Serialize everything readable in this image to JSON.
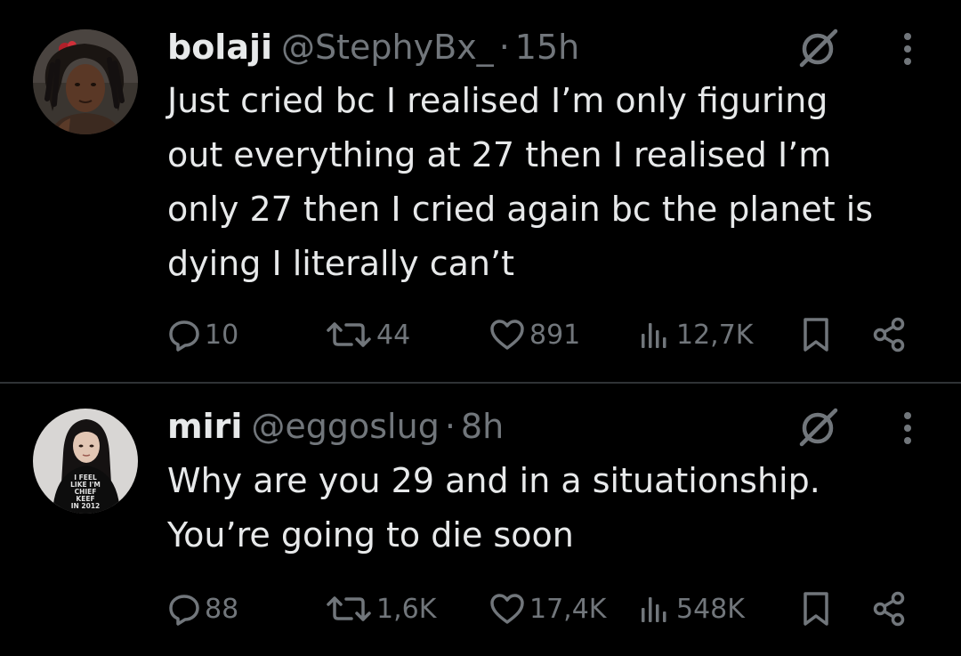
{
  "colors": {
    "background": "#000000",
    "text_primary": "#e7e9ea",
    "text_secondary": "#71767b",
    "divider": "#2f3336"
  },
  "tweets": [
    {
      "author": {
        "display_name": "bolaji",
        "handle": "@StephyBx_",
        "avatar": "avatar-woman-dreadlocks"
      },
      "separator": "·",
      "time": "15h",
      "text": "Just cried bc I realised I’m only figuring\nout everything at 27 then I realised I’m\nonly 27 then I cried again bc the planet is\ndying I literally can’t",
      "stats": {
        "replies": "10",
        "reposts": "44",
        "likes": "891",
        "views": "12,7K"
      },
      "icons": [
        "grok-icon",
        "more-icon",
        "reply-icon",
        "retweet-icon",
        "heart-icon",
        "views-icon",
        "bookmark-icon",
        "share-icon"
      ]
    },
    {
      "author": {
        "display_name": "miri",
        "handle": "@eggoslug",
        "avatar": "avatar-woman-black-tshirt",
        "avatar_shirt_text": [
          "I FEEL",
          "LIKE I'M",
          "CHIEF",
          "KEEF",
          "IN 2012"
        ]
      },
      "separator": "·",
      "time": "8h",
      "text": "Why are you 29 and in a situationship.\nYou’re going to die soon",
      "stats": {
        "replies": "88",
        "reposts": "1,6K",
        "likes": "17,4K",
        "views": "548K"
      },
      "icons": [
        "grok-icon",
        "more-icon",
        "reply-icon",
        "retweet-icon",
        "heart-icon",
        "views-icon",
        "bookmark-icon",
        "share-icon"
      ]
    }
  ]
}
